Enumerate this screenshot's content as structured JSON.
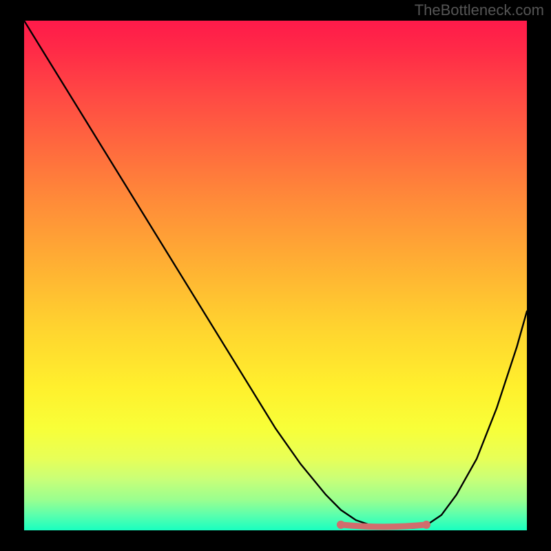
{
  "watermark": "TheBottleneck.com",
  "chart_data": {
    "type": "line",
    "title": "",
    "xlabel": "",
    "ylabel": "",
    "xlim": [
      0,
      100
    ],
    "ylim": [
      0,
      100
    ],
    "grid": false,
    "legend": false,
    "x": [
      0,
      5,
      10,
      15,
      20,
      25,
      30,
      35,
      40,
      45,
      50,
      55,
      60,
      63,
      66,
      69,
      72,
      75,
      78,
      80,
      83,
      86,
      90,
      94,
      98,
      100
    ],
    "values": [
      100,
      92,
      84,
      76,
      68,
      60,
      52,
      44,
      36,
      28,
      20,
      13,
      7,
      4,
      2,
      1,
      0.5,
      0.4,
      0.5,
      1,
      3,
      7,
      14,
      24,
      36,
      43
    ],
    "sweet_spot": {
      "x_start": 63,
      "x_end": 80,
      "y_level": 0.7
    },
    "gradient_colors": {
      "top": "#ff1a4a",
      "mid_upper": "#ff8a39",
      "mid": "#ffd32f",
      "mid_lower": "#f8ff38",
      "bottom": "#18ffc0"
    }
  }
}
